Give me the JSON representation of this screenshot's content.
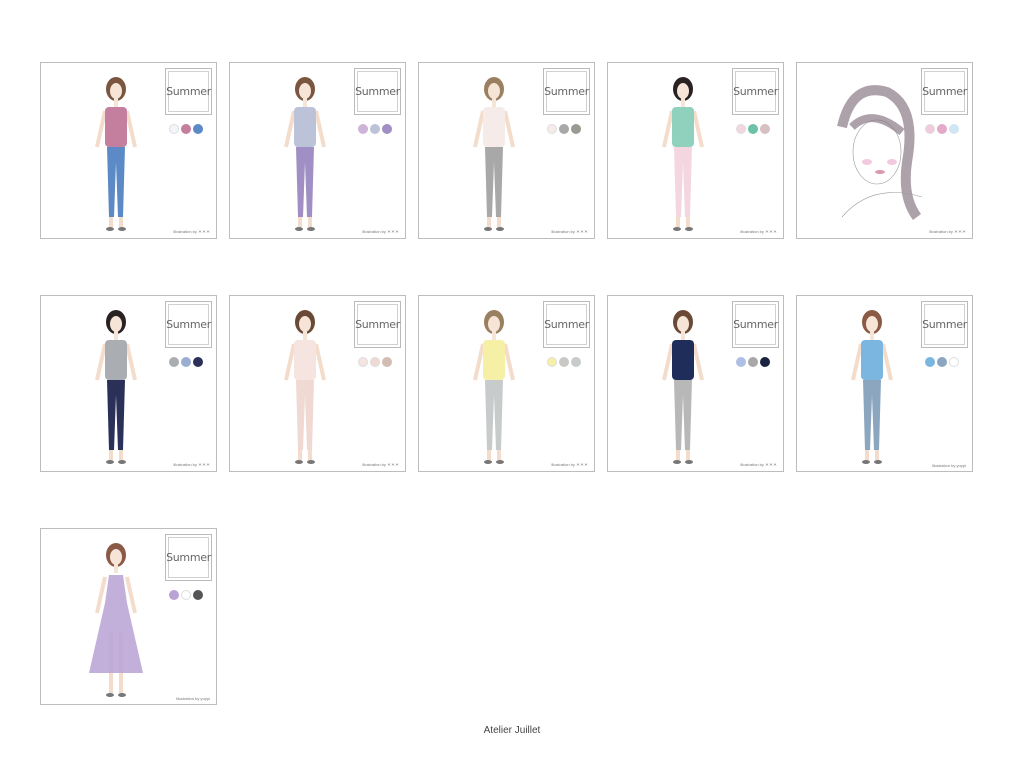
{
  "footer": "Atelier Juillet",
  "cards": [
    {
      "label": "Summer",
      "credit": "Illustration by ＊＊＊",
      "colors": [
        "#f2f6fa",
        "#c47f9e",
        "#5b8ac6"
      ],
      "top": "#c47f9e",
      "bottom": "#5b8ac6",
      "hair": "#7a5540"
    },
    {
      "label": "Summer",
      "credit": "Illustration by ＊＊＊",
      "colors": [
        "#cdb3d6",
        "#bcc2d8",
        "#9f8fc4"
      ],
      "top": "#bcc2d8",
      "bottom": "#9f8fc4",
      "hair": "#7a5540"
    },
    {
      "label": "Summer",
      "credit": "Illustration by ＊＊＊",
      "colors": [
        "#f5ecea",
        "#a8a8a8",
        "#999a92"
      ],
      "top": "#f5ecea",
      "bottom": "#a8a8a8",
      "hair": "#9a8060"
    },
    {
      "label": "Summer",
      "credit": "Illustration by ＊＊＊",
      "colors": [
        "#f3d6e0",
        "#6cc1a6",
        "#d6c0c2"
      ],
      "top": "#8fd1bd",
      "bottom": "#f3d6e0",
      "hair": "#2a2222"
    },
    {
      "label": "Summer",
      "credit": "Illustration by ＊＊＊",
      "colors": [
        "#f2c9dd",
        "#e5a9c9",
        "#d1e6f2"
      ],
      "portrait": true,
      "hair": "#8a7a86"
    },
    {
      "label": "Summer",
      "credit": "Illustration by ＊＊＊",
      "colors": [
        "#aaaeb3",
        "#9caed0",
        "#2a3058"
      ],
      "top": "#aaaeb3",
      "bottom": "#2a3058",
      "hair": "#2a2222"
    },
    {
      "label": "Summer",
      "credit": "Illustration by ＊＊＊",
      "colors": [
        "#f5e4df",
        "#efd9d2",
        "#d3bcb1"
      ],
      "top": "#f5e4df",
      "bottom": "#efd9d2",
      "hair": "#6a4a36"
    },
    {
      "label": "Summer",
      "credit": "Illustration by ＊＊＊",
      "colors": [
        "#f6f0a6",
        "#c8c8c4",
        "#c8cbcc"
      ],
      "top": "#f6f0a6",
      "bottom": "#c8cbcc",
      "hair": "#9a8060"
    },
    {
      "label": "Summer",
      "credit": "Illustration by ＊＊＊",
      "colors": [
        "#aebfe6",
        "#a8a8a8",
        "#1a2440"
      ],
      "top": "#1f2d5a",
      "bottom": "#b8b8b8",
      "hair": "#6a4a36"
    },
    {
      "label": "Summer",
      "credit": "Illustration by yoppi",
      "colors": [
        "#7ab6e0",
        "#8ba6be",
        "#ffffff"
      ],
      "top": "#7ab6e0",
      "bottom": "#8ba6be",
      "hair": "#8a5a46"
    },
    {
      "label": "Summer",
      "credit": "Illustration by yoppi",
      "colors": [
        "#b9a2d4",
        "#ffffff",
        "#555555"
      ],
      "top": "#b9a2d4",
      "bottom": "#c7b3e0",
      "hair": "#8a5a46",
      "dress": true
    }
  ]
}
